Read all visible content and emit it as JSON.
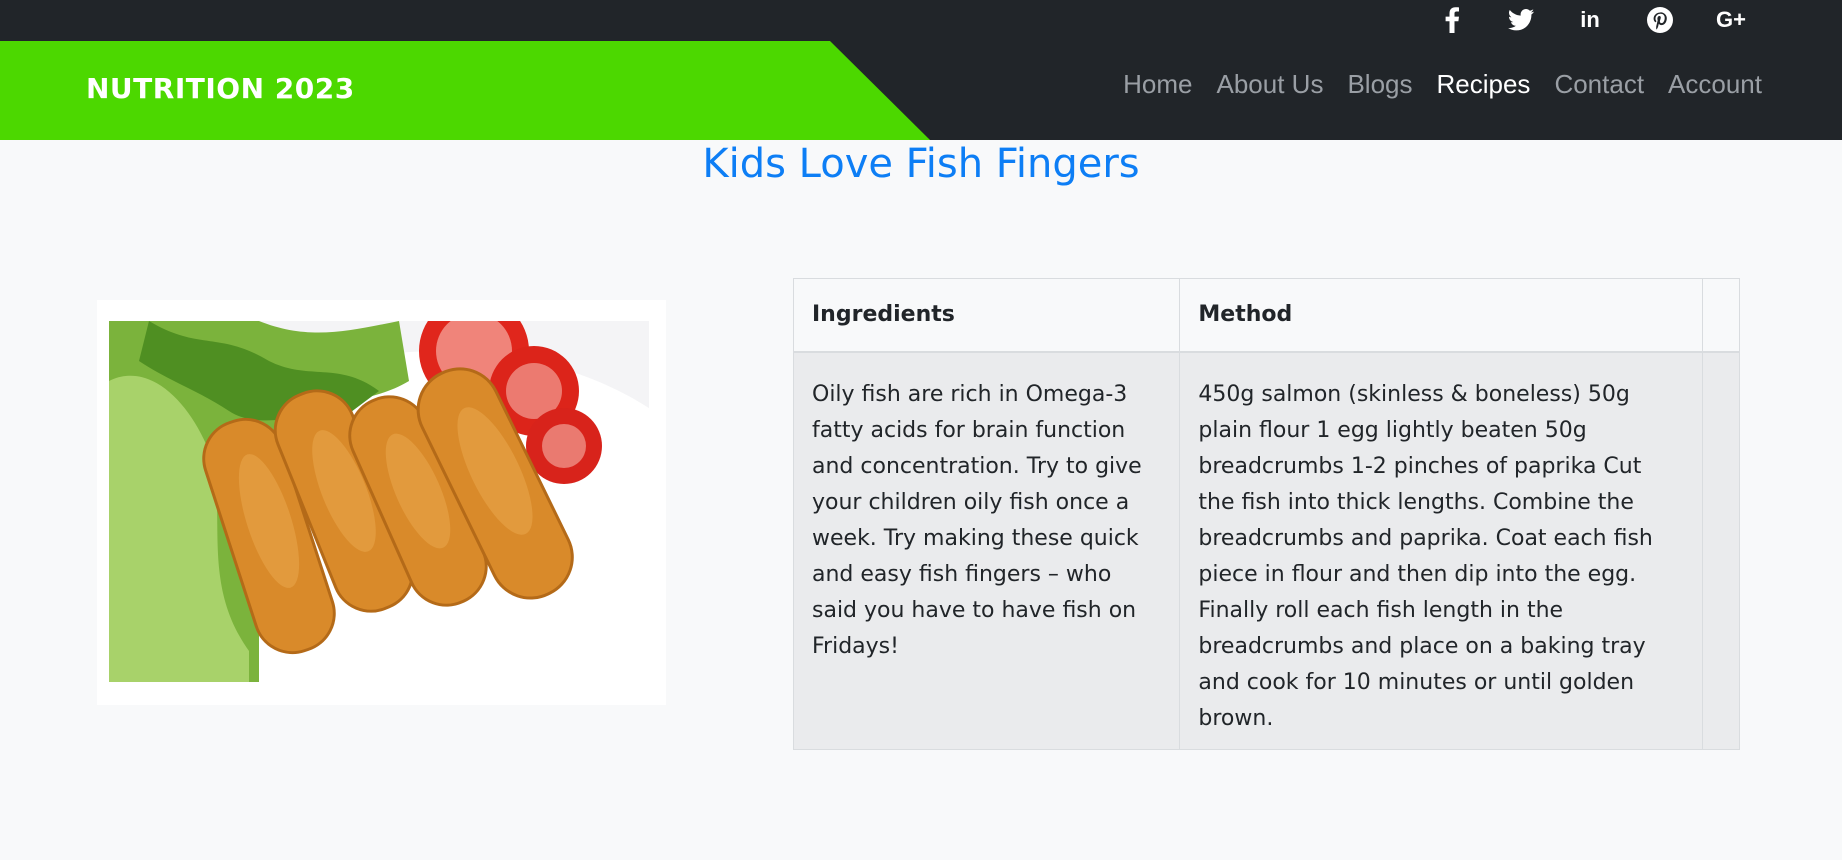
{
  "social": {
    "facebook_icon": "facebook-icon",
    "twitter_icon": "twitter-icon",
    "linkedin_label": "in",
    "pinterest_icon": "pinterest-icon",
    "googleplus_label": "G+"
  },
  "header": {
    "brand": "NUTRITION 2023",
    "brand_color": "#4cd800",
    "nav": [
      {
        "label": "Home"
      },
      {
        "label": "About Us"
      },
      {
        "label": "Blogs"
      },
      {
        "label": "Recipes",
        "active": true
      },
      {
        "label": "Contact"
      },
      {
        "label": "Account"
      }
    ]
  },
  "main": {
    "title": "Kids Love Fish Fingers",
    "title_color": "#0d7ef5",
    "table": {
      "headers": [
        "Ingredients",
        "Method",
        ""
      ],
      "rows": [
        [
          "Oily fish are rich in Omega-3 fatty acids for brain function and concentration. Try to give your children oily fish once a week. Try making these quick and easy fish fingers – who said you have to have fish on Fridays!",
          "450g salmon (skinless & boneless) 50g plain flour 1 egg lightly beaten 50g breadcrumbs 1-2 pinches of paprika Cut the fish into thick lengths. Combine the breadcrumbs and paprika. Coat each fish piece in flour and then dip into the egg. Finally roll each fish length in the breadcrumbs and place on a baking tray and cook for 10 minutes or until golden brown.",
          ""
        ]
      ]
    }
  }
}
